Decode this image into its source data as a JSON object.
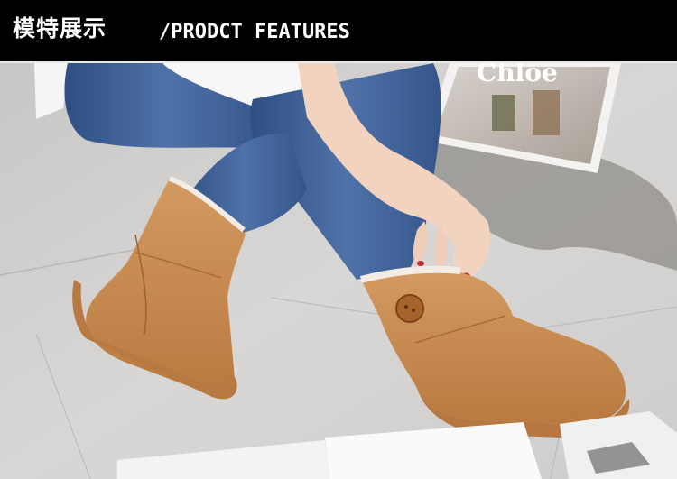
{
  "header": {
    "title_cn": "模特展示",
    "title_en": "/PRODCT FEATURES"
  },
  "photo": {
    "subject": "model-wearing-suede-snow-boots",
    "magazine_logo_text": "Chloe"
  },
  "colors": {
    "header_bg": "#000000",
    "header_text": "#ffffff",
    "boot_suede": "#c8884f",
    "boot_sole": "#b67840",
    "jeans": "#3d5f93",
    "floor": "#d7d5d3"
  }
}
